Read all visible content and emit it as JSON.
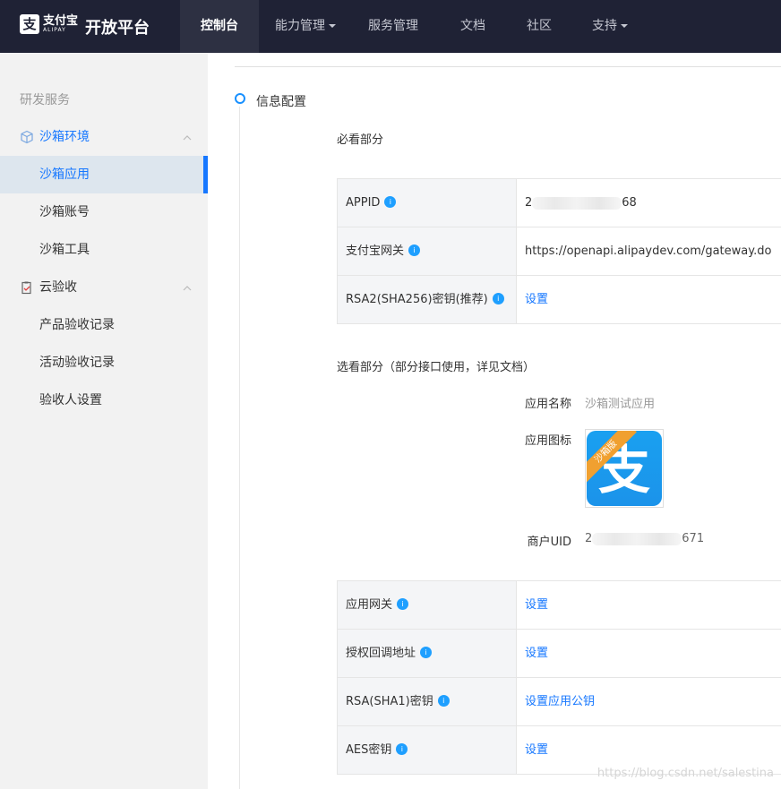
{
  "topbar": {
    "logo_mark": "支",
    "logo_cn": "支付宝",
    "logo_en": "ALIPAY",
    "platform": "开放平台",
    "nav": [
      {
        "label": "控制台"
      },
      {
        "label": "能力管理"
      },
      {
        "label": "服务管理"
      },
      {
        "label": "文档"
      },
      {
        "label": "社区"
      },
      {
        "label": "支持"
      }
    ]
  },
  "sidebar": {
    "group_title": "研发服务",
    "sandbox_env": "沙箱环境",
    "sandbox_app": "沙箱应用",
    "sandbox_account": "沙箱账号",
    "sandbox_tools": "沙箱工具",
    "cloud_accept": "云验收",
    "product_records": "产品验收记录",
    "activity_records": "活动验收记录",
    "acceptor_settings": "验收人设置"
  },
  "main": {
    "step_title": "信息配置",
    "required_title": "必看部分",
    "required_rows": [
      {
        "key": "APPID",
        "value_prefix": "2",
        "value_suffix": "68",
        "link": false
      },
      {
        "key": "支付宝网关",
        "value": "https://openapi.alipaydev.com/gateway.do",
        "link": false
      },
      {
        "key": "RSA2(SHA256)密钥(推荐)",
        "value": "设置",
        "link": true
      }
    ],
    "optional_title": "选看部分（部分接口使用，详见文档）",
    "app_name_label": "应用名称",
    "app_name_value": "沙箱测试应用",
    "app_icon_label": "应用图标",
    "app_icon_glyph": "支",
    "app_icon_ribbon": "沙箱版",
    "merchant_uid_label": "商户UID",
    "merchant_uid_prefix": "2",
    "merchant_uid_suffix": "671",
    "optional_rows": [
      {
        "key": "应用网关",
        "value": "设置"
      },
      {
        "key": "授权回调地址",
        "value": "设置"
      },
      {
        "key": "RSA(SHA1)密钥",
        "value": "设置应用公钥"
      },
      {
        "key": "AES密钥",
        "value": "设置"
      }
    ],
    "info_glyph": "i"
  },
  "watermark": "https://blog.csdn.net/salestina",
  "colors": {
    "topbar": "#1f2235",
    "accent": "#1677ff",
    "info": "#1e9fff",
    "sidebar": "#f2f2f2"
  }
}
